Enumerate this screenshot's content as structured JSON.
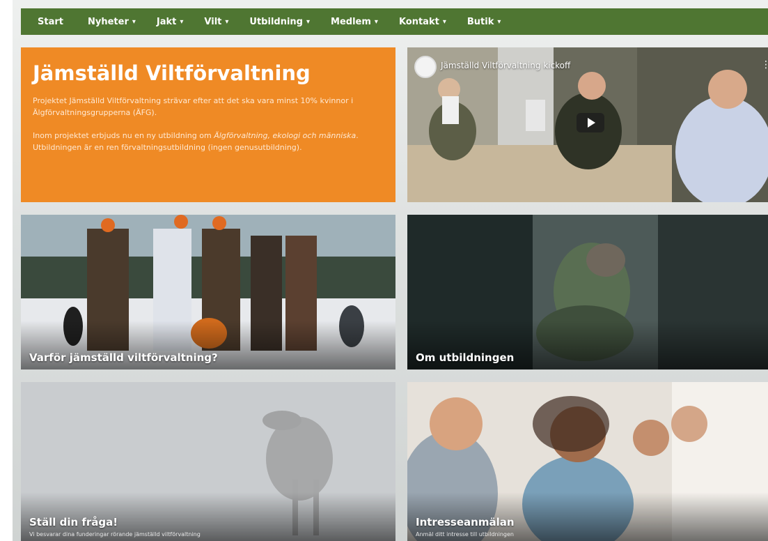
{
  "nav": {
    "items": [
      {
        "label": "Start",
        "caret": ""
      },
      {
        "label": "Nyheter",
        "caret": "▾"
      },
      {
        "label": "Jakt",
        "caret": "▾"
      },
      {
        "label": "Vilt",
        "caret": "▾"
      },
      {
        "label": "Utbildning",
        "caret": "▾"
      },
      {
        "label": "Medlem",
        "caret": "▾"
      },
      {
        "label": "Kontakt",
        "caret": "▾"
      },
      {
        "label": "Butik",
        "caret": "▾"
      }
    ]
  },
  "intro": {
    "title": "Jämställd Viltförvaltning",
    "p1": "Projektet Jämställd Viltförvaltning strävar efter att det ska vara minst 10% kvinnor i Älgförvaltningsgrupperna (ÄFG).",
    "p2_prefix": "Inom projektet erbjuds nu en ny utbildning om ",
    "p2_italic": "Älgförvaltning, ekologi och människa",
    "p2_suffix": ". Utbildningen är en ren förvaltningsutbildning (ingen genusutbildning)."
  },
  "video": {
    "title": "Jämställd Viltförvaltning kickoff",
    "menu": "⋮"
  },
  "tiles": {
    "why": {
      "caption": "Varför jämställd viltförvaltning?"
    },
    "about": {
      "caption": "Om utbildningen"
    },
    "ask": {
      "caption": "Ställ din fråga!",
      "sub": "Vi besvarar dina funderingar rörande jämställd viltförvaltning"
    },
    "interest": {
      "caption": "Intresseanmälan",
      "sub": "Anmäl ditt intresse till utbildningen"
    }
  },
  "colors": {
    "nav_green": "#4f7632",
    "intro_orange": "#ef8a25"
  }
}
